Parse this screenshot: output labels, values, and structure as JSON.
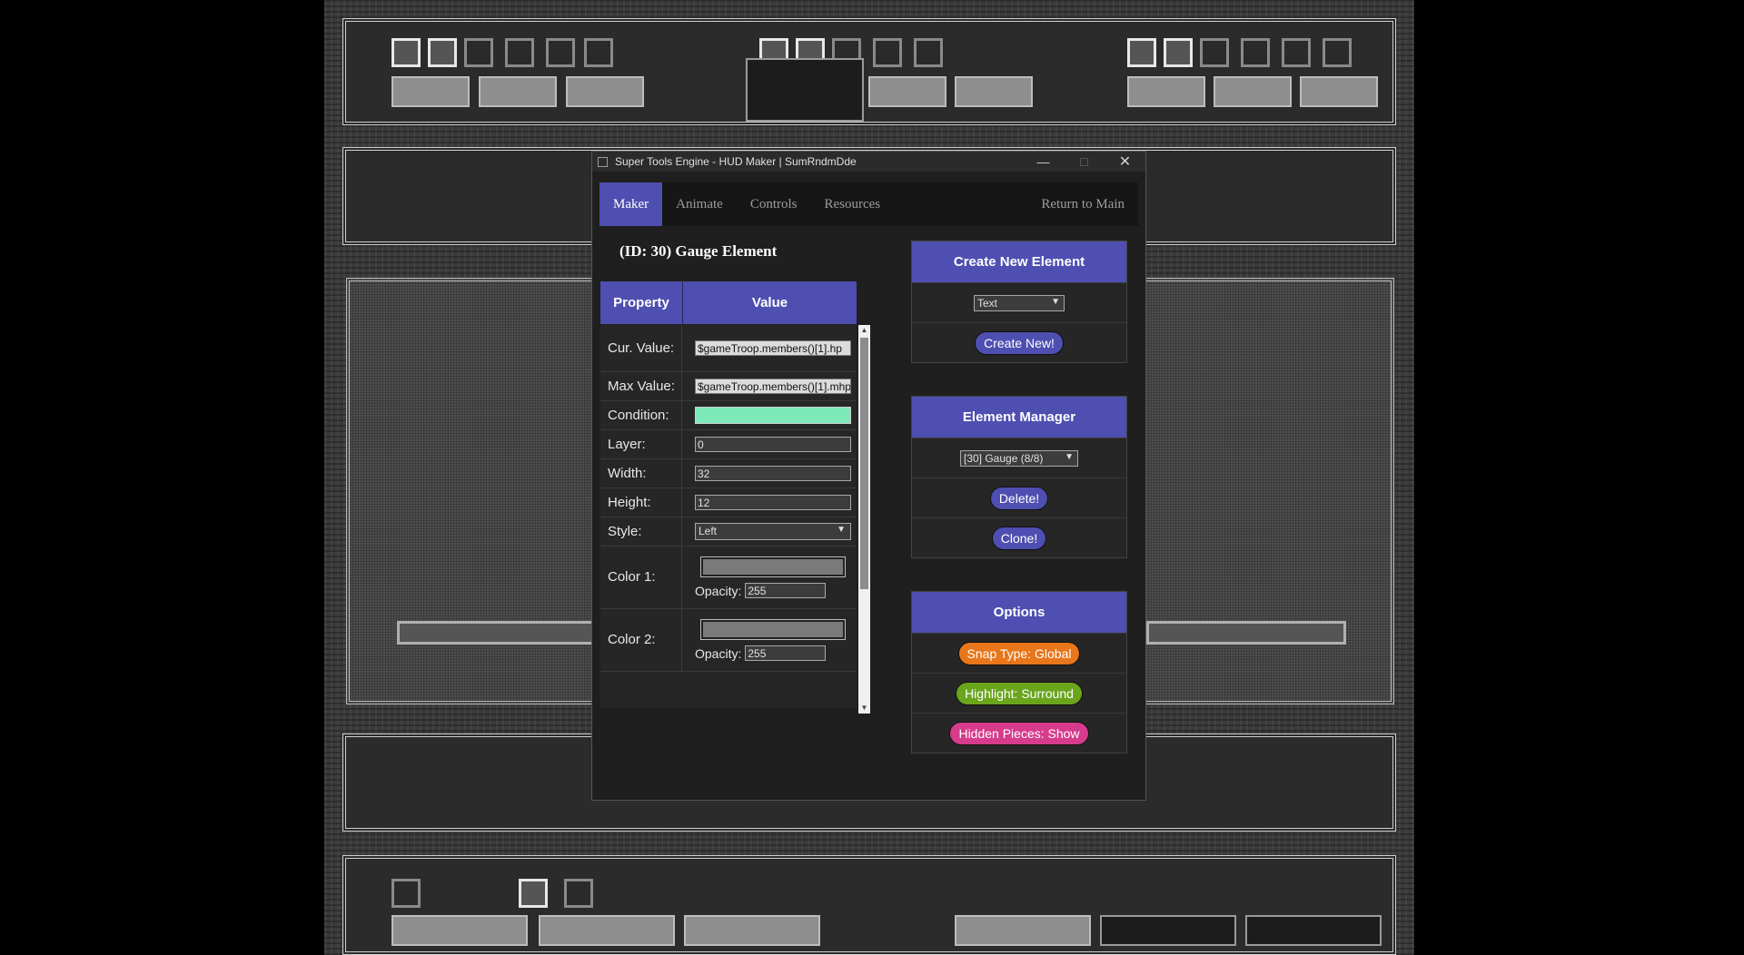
{
  "window": {
    "title": "Super Tools Engine  -  HUD Maker | SumRndmDde",
    "minimize": "—",
    "maximize": "□",
    "close": "✕"
  },
  "tabs": [
    {
      "label": "Maker"
    },
    {
      "label": "Animate"
    },
    {
      "label": "Controls"
    },
    {
      "label": "Resources"
    }
  ],
  "return_label": "Return to Main",
  "element_title": "(ID: 30) Gauge Element",
  "table": {
    "header_property": "Property",
    "header_value": "Value",
    "rows": {
      "cur_value": {
        "label": "Cur. Value:",
        "value": "$gameTroop.members()[1].hp"
      },
      "max_value": {
        "label": "Max Value:",
        "value": "$gameTroop.members()[1].mhp"
      },
      "condition": {
        "label": "Condition:",
        "value": ""
      },
      "layer": {
        "label": "Layer:",
        "value": "0"
      },
      "width": {
        "label": "Width:",
        "value": "32"
      },
      "height": {
        "label": "Height:",
        "value": "12"
      },
      "style": {
        "label": "Style:",
        "value": "Left"
      },
      "color1": {
        "label": "Color 1:",
        "opacity_label": "Opacity:",
        "opacity": "255"
      },
      "color2": {
        "label": "Color 2:",
        "opacity_label": "Opacity:",
        "opacity": "255"
      }
    }
  },
  "create_panel": {
    "title": "Create New Element",
    "type_value": "Text",
    "create_label": "Create New!"
  },
  "manager_panel": {
    "title": "Element Manager",
    "selected": "[30] Gauge (8/8)",
    "delete_label": "Delete!",
    "clone_label": "Clone!"
  },
  "options_panel": {
    "title": "Options",
    "snap_label": "Snap Type: Global",
    "highlight_label": "Highlight: Surround",
    "hidden_label": "Hidden Pieces: Show"
  },
  "colors": {
    "accent": "#4e4fb0",
    "condition_fill": "#7de8b8",
    "snap": "#e8761a",
    "highlight": "#6aa51c",
    "hidden": "#d63b8c"
  },
  "icons": {
    "app": "window-app-icon",
    "dropdown": "chevron-down-icon",
    "scroll_up": "scroll-up-arrow-icon",
    "scroll_down": "scroll-down-arrow-icon"
  }
}
